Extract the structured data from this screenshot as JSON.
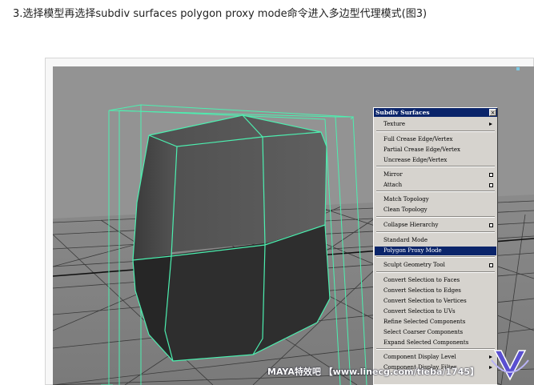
{
  "caption": "3.选择模型再选择subdiv surfaces polygon proxy mode命令进入多边型代理模式(图3)",
  "menu": {
    "title": "Subdiv Surfaces",
    "close_label": "×",
    "items": [
      {
        "label": "Texture",
        "marker": "arrow"
      },
      {
        "label": "Full Crease Edge/Vertex"
      },
      {
        "label": "Partial Crease Edge/Vertex"
      },
      {
        "label": "Uncrease Edge/Vertex"
      },
      {
        "label": "Mirror",
        "marker": "box"
      },
      {
        "label": "Attach",
        "marker": "box"
      },
      {
        "label": "Match Topology"
      },
      {
        "label": "Clean Topology"
      },
      {
        "label": "Collapse Hierarchy",
        "marker": "box"
      },
      {
        "label": "Standard Mode"
      },
      {
        "label": "Polygon Proxy Mode",
        "selected": true
      },
      {
        "label": "Sculpt Geometry Tool",
        "marker": "box"
      },
      {
        "label": "Convert Selection to Faces"
      },
      {
        "label": "Convert Selection to Edges"
      },
      {
        "label": "Convert Selection to Vertices"
      },
      {
        "label": "Convert Selection to UVs"
      },
      {
        "label": "Refine Selected Components"
      },
      {
        "label": "Select Coarser Components"
      },
      {
        "label": "Expand Selected Components"
      },
      {
        "label": "Component Display Level",
        "marker": "arrow"
      },
      {
        "label": "Component Display Filter",
        "marker": "arrow"
      }
    ]
  },
  "watermark": "MAYA特效吧 【www.linecg.com/tieba/1745】",
  "colors": {
    "viewport_bg": "#8f8f8f",
    "wireframe": "#4cf0b0",
    "menu_bg": "#d6d3ce",
    "highlight": "#0a246a"
  }
}
